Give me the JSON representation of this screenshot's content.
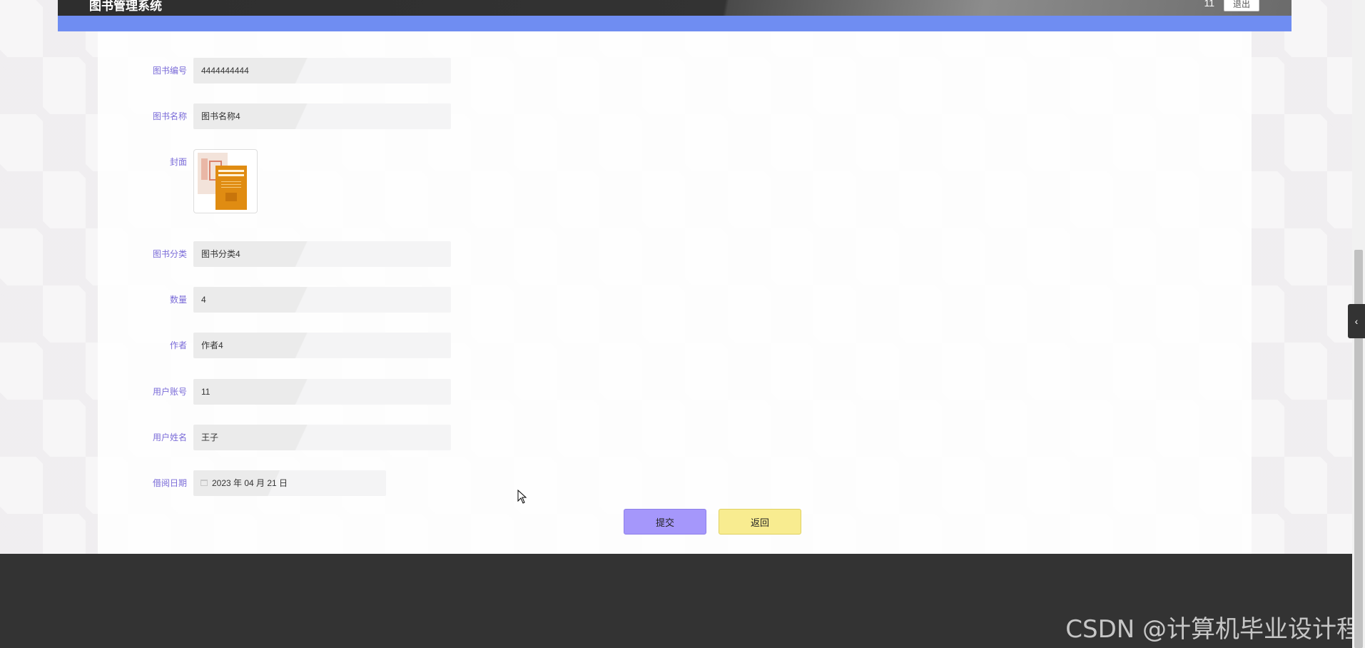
{
  "header": {
    "system_title": "图书管理系统",
    "user_name": "11",
    "logout_label": "退出"
  },
  "form": {
    "fields": [
      {
        "label": "图书编号",
        "value": "4444444444"
      },
      {
        "label": "图书名称",
        "value": "图书名称4"
      },
      {
        "label": "封面",
        "value": ""
      },
      {
        "label": "图书分类",
        "value": "图书分类4"
      },
      {
        "label": "数量",
        "value": "4"
      },
      {
        "label": "作者",
        "value": "作者4"
      },
      {
        "label": "用户账号",
        "value": "11"
      },
      {
        "label": "用户姓名",
        "value": "王子"
      },
      {
        "label": "借阅日期",
        "value": "2023 年 04 月 21 日"
      }
    ],
    "submit_label": "提交",
    "back_label": "返回"
  },
  "footer": {
    "watermark": "CSDN @计算机毕业设计程"
  },
  "colors": {
    "accent_band": "#6f8df2",
    "label_text": "#7a6bd8",
    "submit_button": "#a597fb",
    "back_button": "#f8ec90",
    "footer_bg": "#333333"
  },
  "icons": {
    "date_field": "calendar-icon",
    "side_toggle": "chevron-left-icon",
    "pointer": "cursor-icon"
  }
}
